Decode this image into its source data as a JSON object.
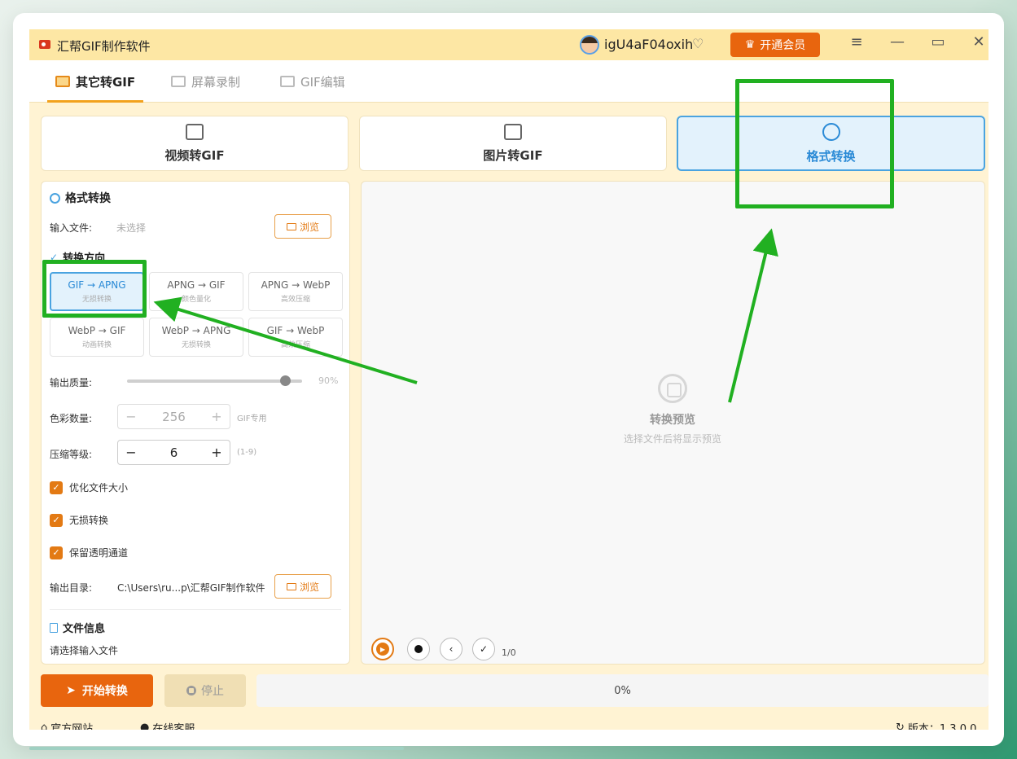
{
  "app": {
    "title": "汇帮GIF制作软件"
  },
  "header": {
    "username": "igU4aF04oxih",
    "vip_button": "开通会员"
  },
  "tabs": [
    {
      "label": "其它转GIF",
      "active": true
    },
    {
      "label": "屏幕录制",
      "active": false
    },
    {
      "label": "GIF编辑",
      "active": false
    }
  ],
  "modes": [
    {
      "label": "视频转GIF",
      "active": false
    },
    {
      "label": "图片转GIF",
      "active": false
    },
    {
      "label": "格式转换",
      "active": true
    }
  ],
  "panel": {
    "title": "格式转换",
    "input_label": "输入文件:",
    "input_value": "未选择",
    "browse": "浏览",
    "direction_title": "转换方向",
    "directions": [
      {
        "label": "GIF → APNG",
        "sub": "无损转换",
        "active": true
      },
      {
        "label": "APNG → GIF",
        "sub": "颜色量化",
        "active": false
      },
      {
        "label": "APNG → WebP",
        "sub": "高效压缩",
        "active": false
      },
      {
        "label": "WebP → GIF",
        "sub": "动画转换",
        "active": false
      },
      {
        "label": "WebP → APNG",
        "sub": "无损转换",
        "active": false
      },
      {
        "label": "GIF → WebP",
        "sub": "高效压缩",
        "active": false
      }
    ],
    "quality_label": "输出质量:",
    "quality_value": "90%",
    "quality_level": 0.9,
    "colors_label": "色彩数量:",
    "colors_value": "256",
    "colors_note": "GIF专用",
    "compress_label": "压缩等级:",
    "compress_value": "6",
    "compress_note": "(1-9)",
    "options": [
      {
        "label": "优化文件大小",
        "checked": true
      },
      {
        "label": "无损转换",
        "checked": true
      },
      {
        "label": "保留透明通道",
        "checked": true
      }
    ],
    "output_label": "输出目录:",
    "output_value": "C:\\Users\\ru...p\\汇帮GIF制作软件",
    "fileinfo_title": "文件信息",
    "fileinfo_value": "请选择输入文件"
  },
  "preview": {
    "title": "转换预览",
    "subtitle": "选择文件后将显示预览",
    "frame_count": "1/0"
  },
  "actions": {
    "start": "开始转换",
    "stop": "停止",
    "progress": "0%",
    "progress_value": 0
  },
  "status": {
    "website": "官方网站",
    "support": "在线客服",
    "version": "版本：1.3.0.0"
  },
  "colors": {
    "accent": "#e8650e",
    "highlight": "#21b021",
    "selected": "#4aa3e0"
  }
}
